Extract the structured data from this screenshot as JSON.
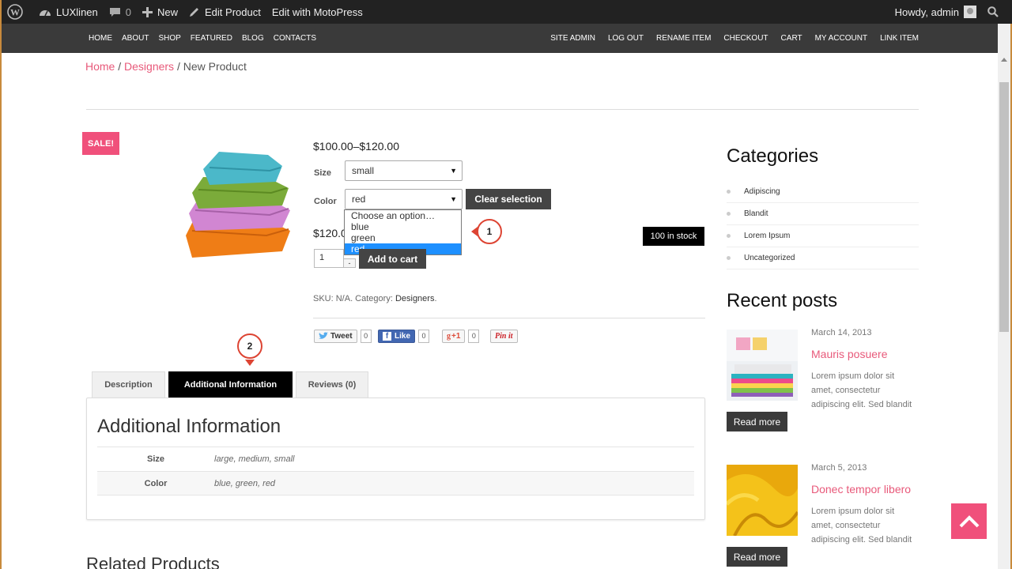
{
  "admin_bar": {
    "site_name": "LUXlinen",
    "comments_count": "0",
    "new_label": "New",
    "edit_label": "Edit Product",
    "motopress_label": "Edit with MotoPress",
    "howdy": "Howdy, admin"
  },
  "nav": {
    "left": [
      "HOME",
      "ABOUT",
      "SHOP",
      "FEATURED",
      "BLOG",
      "CONTACTS"
    ],
    "right": [
      "SITE ADMIN",
      "LOG OUT",
      "RENAME ITEM",
      "CHECKOUT",
      "CART",
      "MY ACCOUNT",
      "LINK ITEM"
    ]
  },
  "breadcrumb": {
    "home": "Home",
    "sep": " / ",
    "category": "Designers",
    "current": "New Product"
  },
  "product": {
    "sale_badge": "SALE!",
    "price_range": "$100.00–$120.00",
    "size_label": "Size",
    "size_value": "small",
    "color_label": "Color",
    "color_value": "red",
    "clear_label": "Clear selection",
    "color_options": [
      "Choose an option…",
      "blue",
      "green",
      "red"
    ],
    "variation_price": "$120.00",
    "stock": "100 in stock",
    "quantity": "1",
    "qty_minus": "-",
    "add_to_cart": "Add to cart",
    "sku_text": "SKU: N/A. Category: ",
    "category": "Designers",
    "category_end": "."
  },
  "markers": [
    "1",
    "2"
  ],
  "share": {
    "tweet": "Tweet",
    "tweet_count": "0",
    "like": "Like",
    "like_count": "0",
    "gplus": "+1",
    "gplus_count": "0",
    "pin": "Pin it"
  },
  "tabs": {
    "description": "Description",
    "additional": "Additional Information",
    "reviews": "Reviews (0)"
  },
  "additional_info": {
    "heading": "Additional Information",
    "rows": [
      {
        "key": "Size",
        "value": "large, medium, small"
      },
      {
        "key": "Color",
        "value": "blue, green, red"
      }
    ]
  },
  "related_heading": "Related Products",
  "sidebar": {
    "categories_heading": "Categories",
    "categories": [
      "Adipiscing",
      "Blandit",
      "Lorem Ipsum",
      "Uncategorized"
    ],
    "recent_heading": "Recent posts",
    "posts": [
      {
        "date": "March 14, 2013",
        "title": "Mauris posuere",
        "excerpt": "Lorem ipsum dolor sit amet, consectetur adipiscing elit. Sed blandit",
        "read_more": "Read more"
      },
      {
        "date": "March 5, 2013",
        "title": "Donec tempor libero",
        "excerpt": "Lorem ipsum dolor sit amet, consectetur adipiscing elit. Sed blandit",
        "read_more": "Read more"
      }
    ]
  },
  "colors": {
    "accent": "#e8597a",
    "sale": "#f0507b",
    "nav_bg": "#3a3a3a",
    "admin_bg": "#222222",
    "selected_option": "#1e90ff"
  },
  "icons": [
    "wordpress-icon",
    "dashboard-icon",
    "comment-icon",
    "plus-icon",
    "pencil-icon",
    "search-icon",
    "chevron-up-icon"
  ]
}
